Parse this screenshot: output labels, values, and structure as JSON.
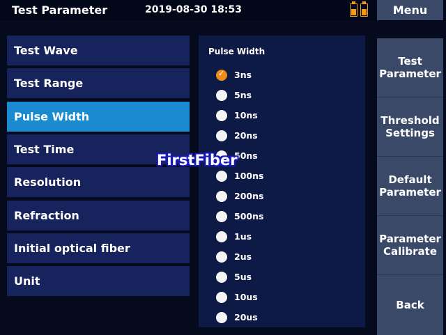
{
  "header": {
    "title": "Test Parameter",
    "datetime": "2019-08-30 18:53",
    "menu_label": "Menu",
    "battery_icons": [
      "battery-icon",
      "battery-icon"
    ],
    "accent_color": "#f39a14"
  },
  "left_menu": {
    "items": [
      {
        "label": "Test Wave",
        "active": false
      },
      {
        "label": "Test Range",
        "active": false
      },
      {
        "label": "Pulse Width",
        "active": true
      },
      {
        "label": "Test Time",
        "active": false
      },
      {
        "label": "Resolution",
        "active": false
      },
      {
        "label": "Refraction",
        "active": false
      },
      {
        "label": "Initial optical fiber",
        "active": false
      },
      {
        "label": "Unit",
        "active": false
      }
    ],
    "active_color": "#1a8bd0"
  },
  "pulse_panel": {
    "title": "Pulse Width",
    "selected": "3ns",
    "options": [
      "3ns",
      "5ns",
      "10ns",
      "20ns",
      "50ns",
      "100ns",
      "200ns",
      "500ns",
      "1us",
      "2us",
      "5us",
      "10us",
      "20us"
    ]
  },
  "right_menu": {
    "buttons": [
      {
        "label": "Test\nParameter"
      },
      {
        "label": "Threshold\nSettings"
      },
      {
        "label": "Default\nParameter"
      },
      {
        "label": "Parameter\nCalibrate"
      },
      {
        "label": "Back"
      }
    ]
  },
  "watermark": "FirstFiber"
}
